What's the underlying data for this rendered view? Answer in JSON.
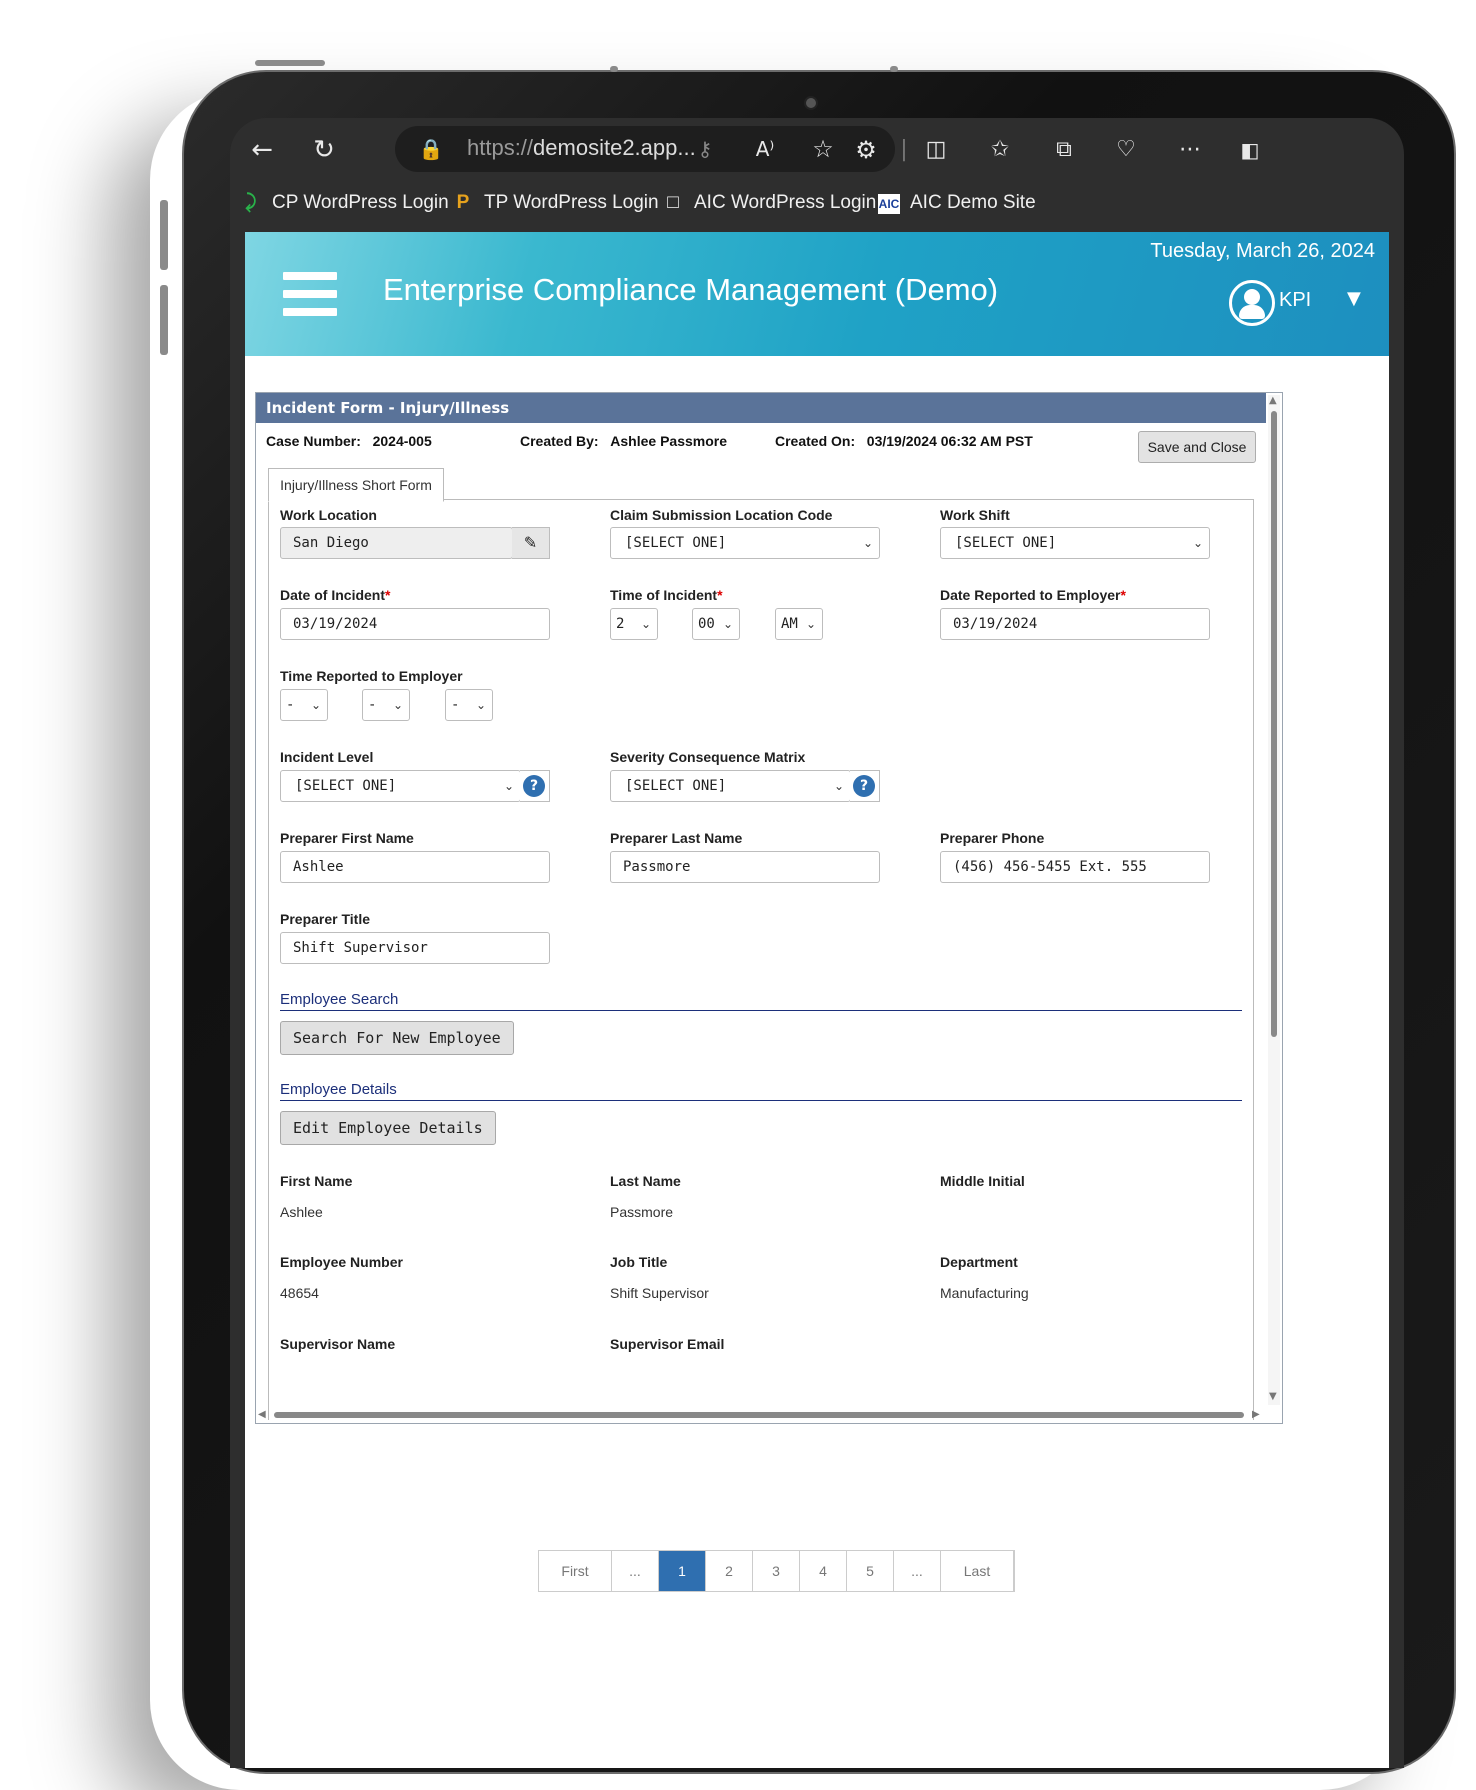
{
  "browser": {
    "url_prefix": "https://",
    "url_domain": "demosite2.app...",
    "bookmarks": [
      {
        "label": "CP WordPress Login",
        "icon": "cp-logo-icon"
      },
      {
        "label": "TP WordPress Login",
        "icon": "tp-logo-icon"
      },
      {
        "label": "AIC WordPress Login",
        "icon": "document-icon"
      },
      {
        "label": "AIC Demo Site",
        "icon": "aic-logo-icon"
      }
    ]
  },
  "header": {
    "title": "Enterprise Compliance Management (Demo)",
    "date": "Tuesday, March 26, 2024",
    "user_label": "KPI",
    "accent": "#1fa2c6"
  },
  "form": {
    "title": "Incident Form - Injury/Illness",
    "case_number_label": "Case Number:",
    "case_number": "2024-005",
    "created_by_label": "Created By:",
    "created_by": "Ashlee Passmore",
    "created_on_label": "Created On:",
    "created_on": "03/19/2024 06:32 AM PST",
    "save_close": "Save and Close",
    "tab": "Injury/Illness Short Form",
    "work_location": {
      "label": "Work Location",
      "value": "San Diego"
    },
    "claim_location": {
      "label": "Claim Submission Location Code",
      "value": "[SELECT ONE]"
    },
    "work_shift": {
      "label": "Work Shift",
      "value": "[SELECT ONE]"
    },
    "date_incident": {
      "label": "Date of Incident",
      "value": "03/19/2024"
    },
    "time_incident": {
      "label": "Time of Incident",
      "hour": "2",
      "minute": "00",
      "ampm": "AM"
    },
    "date_reported": {
      "label": "Date Reported to Employer",
      "value": "03/19/2024"
    },
    "time_reported": {
      "label": "Time Reported to Employer",
      "hour": "-",
      "minute": "-",
      "ampm": "-"
    },
    "incident_level": {
      "label": "Incident Level",
      "value": "[SELECT ONE]"
    },
    "severity": {
      "label": "Severity Consequence Matrix",
      "value": "[SELECT ONE]"
    },
    "preparer_first": {
      "label": "Preparer First Name",
      "value": "Ashlee"
    },
    "preparer_last": {
      "label": "Preparer Last Name",
      "value": "Passmore"
    },
    "preparer_phone": {
      "label": "Preparer Phone",
      "value": "(456) 456-5455 Ext. 555"
    },
    "preparer_title": {
      "label": "Preparer Title",
      "value": "Shift Supervisor"
    },
    "employee_search_title": "Employee Search",
    "search_button": "Search For New Employee",
    "employee_details_title": "Employee Details",
    "edit_button": "Edit Employee Details",
    "first_name": {
      "label": "First Name",
      "value": "Ashlee"
    },
    "last_name": {
      "label": "Last Name",
      "value": "Passmore"
    },
    "middle_initial": {
      "label": "Middle Initial",
      "value": ""
    },
    "employee_number": {
      "label": "Employee Number",
      "value": "48654"
    },
    "job_title": {
      "label": "Job Title",
      "value": "Shift Supervisor"
    },
    "department": {
      "label": "Department",
      "value": "Manufacturing"
    },
    "supervisor_name": {
      "label": "Supervisor Name"
    },
    "supervisor_email": {
      "label": "Supervisor Email"
    }
  },
  "pager": {
    "first": "First",
    "prev": "...",
    "pages": [
      "1",
      "2",
      "3",
      "4",
      "5"
    ],
    "next": "...",
    "last": "Last",
    "active_page": "1"
  }
}
